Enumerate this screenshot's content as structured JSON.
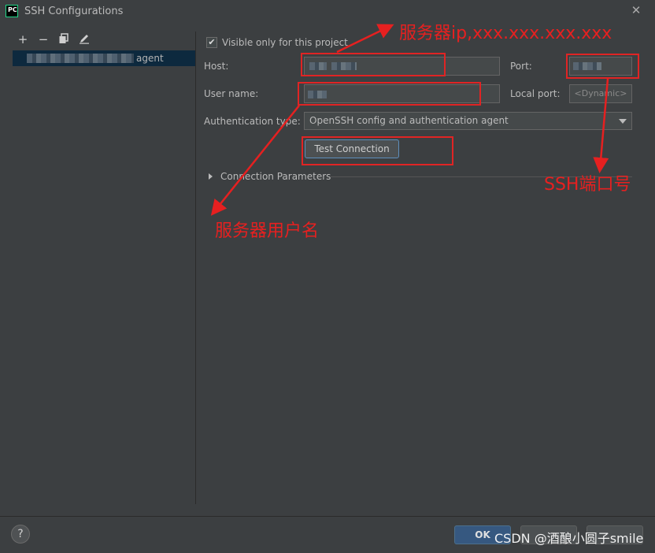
{
  "window": {
    "app_icon": "PC",
    "title": "SSH Configurations",
    "close_glyph": "✕"
  },
  "toolbar": {
    "add_glyph": "+",
    "remove_glyph": "−",
    "copy_icon": "copy-icon",
    "edit_icon": "pencil-icon"
  },
  "left_list": {
    "items": [
      {
        "label": "agent"
      }
    ]
  },
  "form": {
    "visible_only_label": "Visible only for this project",
    "visible_only_checked": true,
    "host_label": "Host:",
    "port_label": "Port:",
    "user_label": "User name:",
    "local_port_label": "Local port:",
    "local_port_placeholder": "<Dynamic>",
    "auth_label": "Authentication type:",
    "auth_value": "OpenSSH config and authentication agent",
    "test_button": "Test Connection",
    "section_title": "Connection Parameters"
  },
  "annotations": {
    "host_note": "服务器ip,xxx.xxx.xxx.xxx",
    "port_note": "SSH端口号",
    "user_note": "服务器用户名",
    "color": "#e62020"
  },
  "footer": {
    "help": "?",
    "ok": "OK",
    "watermark": "CSDN @酒酿小圆子smile"
  },
  "colors": {
    "background": "#3c3f41",
    "field": "#45494a",
    "selection": "#0d293e",
    "accent": "#365880"
  }
}
